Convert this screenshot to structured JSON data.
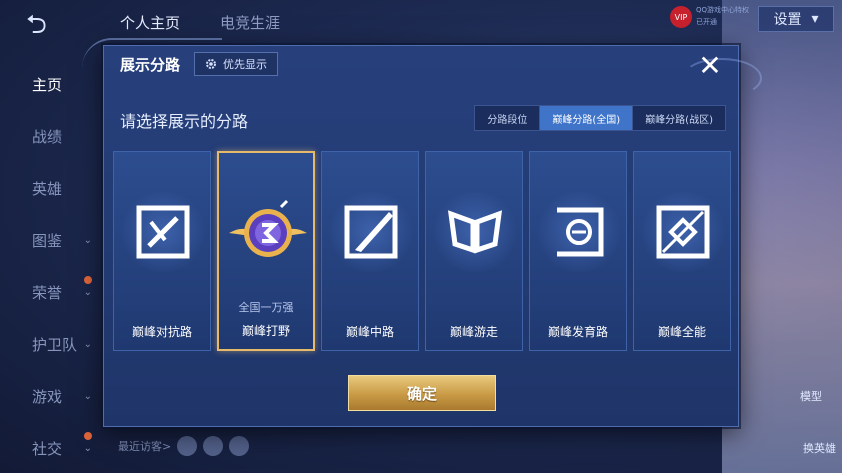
{
  "header": {
    "tabs": [
      "个人主页",
      "电竞生涯"
    ],
    "settings_label": "设置",
    "vip_badge": "VIP",
    "vip_text": "QQ游戏中心特权 已开通"
  },
  "sidebar": {
    "items": [
      {
        "label": "主页"
      },
      {
        "label": "战绩"
      },
      {
        "label": "英雄"
      },
      {
        "label": "图鉴"
      },
      {
        "label": "荣誉"
      },
      {
        "label": "护卫队"
      },
      {
        "label": "游戏"
      },
      {
        "label": "社交"
      }
    ]
  },
  "footer": {
    "recent_visitors": "最近访客>",
    "right_btn_1": "模型",
    "right_btn_2": "换英雄"
  },
  "modal": {
    "title": "展示分路",
    "priority_label": "优先显示",
    "close_symbol": "✕",
    "subtitle": "请选择展示的分路",
    "tabs": [
      {
        "label": "分路段位"
      },
      {
        "label": "巅峰分路(全国)"
      },
      {
        "label": "巅峰分路(战区)"
      }
    ],
    "cards": [
      {
        "label": "巅峰对抗路",
        "sub": ""
      },
      {
        "label": "巅峰打野",
        "sub": "全国一万强"
      },
      {
        "label": "巅峰中路",
        "sub": ""
      },
      {
        "label": "巅峰游走",
        "sub": ""
      },
      {
        "label": "巅峰发育路",
        "sub": ""
      },
      {
        "label": "巅峰全能",
        "sub": ""
      }
    ],
    "confirm_label": "确定"
  },
  "colors": {
    "accent_gold": "#e7b96a",
    "tab_active": "#3f74c9"
  }
}
